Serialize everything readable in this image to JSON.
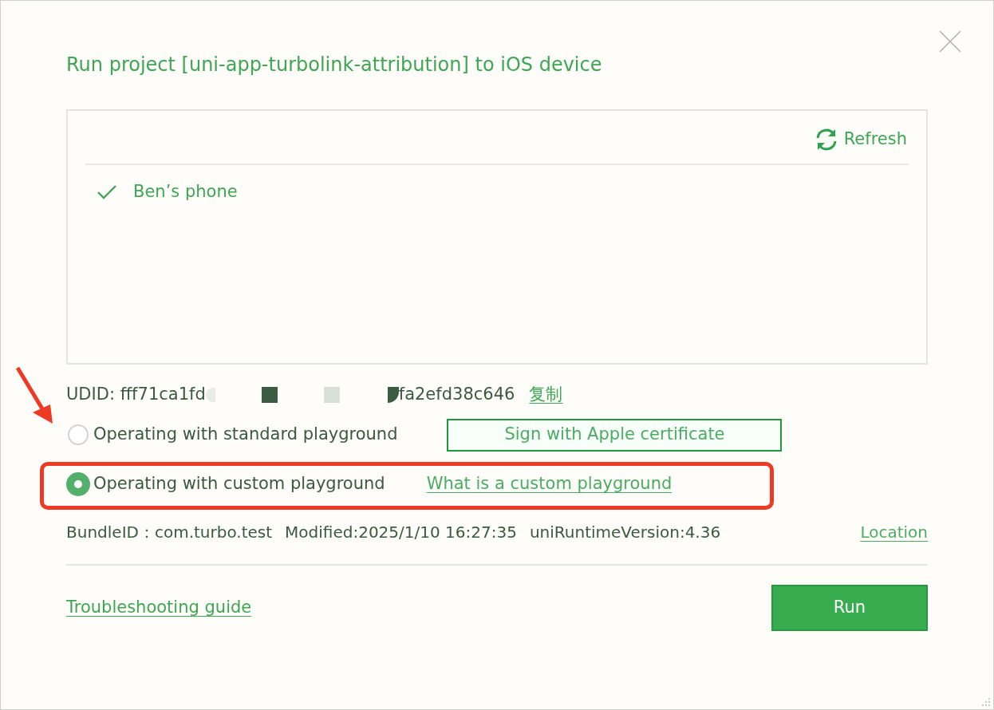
{
  "dialog": {
    "title": "Run project [uni-app-turbolink-attribution] to iOS device"
  },
  "device_list": {
    "refresh": "Refresh",
    "devices": [
      {
        "name": "Ben’s phone",
        "selected": true
      }
    ]
  },
  "udid": {
    "text_start": "UDID: fff71ca1fd",
    "text_end": "fa2efd38c646",
    "copy_link": "复制"
  },
  "modes": [
    {
      "label": "Operating with standard playground",
      "selected": false,
      "action": "Sign with Apple certificate",
      "kind": "button",
      "highlighted": false,
      "pointed": true
    },
    {
      "label": "Operating with custom playground",
      "selected": true,
      "action": "What is a custom playground",
      "kind": "link",
      "highlighted": true,
      "pointed": false
    }
  ],
  "bundle_info": {
    "items": [
      "BundleID：com.turbo.test",
      "Modified:2025/1/10 16:27:35",
      "uniRuntimeVersion:4.36"
    ],
    "link": "Location"
  },
  "footer": {
    "link": "Troubleshooting guide",
    "button": "Run"
  }
}
